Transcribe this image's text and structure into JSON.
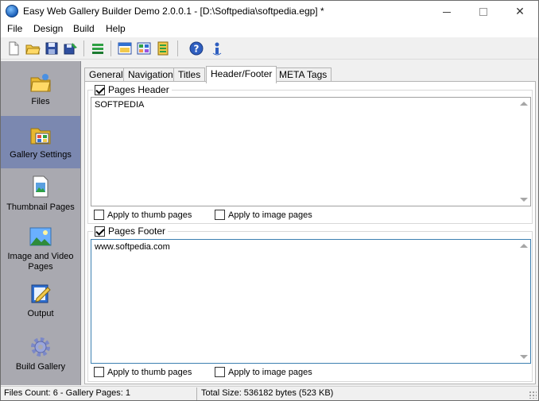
{
  "window": {
    "title": "Easy Web Gallery Builder Demo 2.0.0.1 - [D:\\Softpedia\\softpedia.egp] *",
    "minimize_glyph": "—",
    "close_glyph": "✕"
  },
  "menu": [
    "File",
    "Design",
    "Build",
    "Help"
  ],
  "toolbar": {
    "icons": [
      "new-icon",
      "open-icon",
      "save-icon",
      "save-as-icon",
      "add-files-icon",
      "preview-icon",
      "gallery-icon",
      "publish-icon",
      "help-icon",
      "about-icon"
    ]
  },
  "sidebar": {
    "items": [
      {
        "label": "Files",
        "icon": "folder-icon"
      },
      {
        "label": "Gallery Settings",
        "icon": "gallery-settings-icon",
        "active": true
      },
      {
        "label": "Thumbnail Pages",
        "icon": "thumbnail-page-icon"
      },
      {
        "label": "Image and Video Pages",
        "icon": "image-page-icon"
      },
      {
        "label": "Output",
        "icon": "output-icon"
      },
      {
        "label": "Build Gallery",
        "icon": "build-gear-icon"
      }
    ]
  },
  "tabs": [
    {
      "label": "General"
    },
    {
      "label": "Navigation"
    },
    {
      "label": "Titles"
    },
    {
      "label": "Header/Footer",
      "active": true
    },
    {
      "label": "META Tags"
    }
  ],
  "header_section": {
    "label": "Pages Header",
    "checked": true,
    "text": "SOFTPEDIA",
    "apply_thumb": "Apply to thumb pages",
    "apply_image": "Apply to image pages",
    "apply_thumb_checked": false,
    "apply_image_checked": false
  },
  "footer_section": {
    "label": "Pages Footer",
    "checked": true,
    "text": "www.softpedia.com",
    "apply_thumb": "Apply to thumb pages",
    "apply_image": "Apply to image pages",
    "apply_thumb_checked": false,
    "apply_image_checked": false
  },
  "status": {
    "files": "Files Count: 6 - Gallery Pages: 1",
    "size": "Total Size: 536182 bytes (523 KB)"
  },
  "colors": {
    "nav_bg": "#a9a9b0",
    "nav_active": "#7b88b0",
    "focus_border": "#3c7fb1"
  }
}
